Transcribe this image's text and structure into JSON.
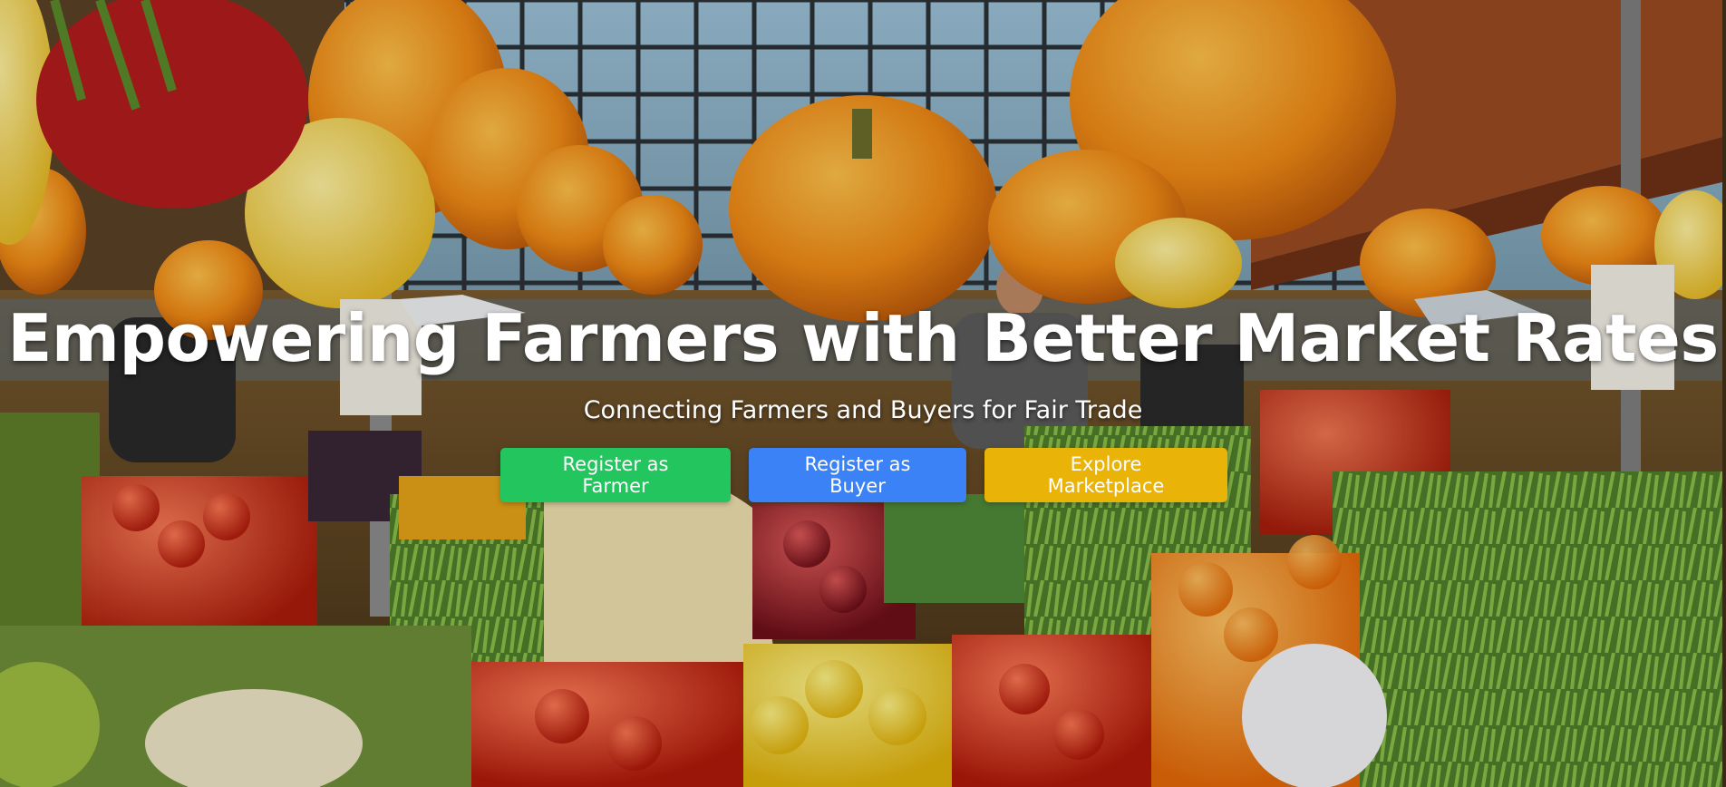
{
  "hero": {
    "title": "Empowering Farmers with Better Market Rates",
    "subtitle": "Connecting Farmers and Buyers for Fair Trade",
    "background": "farmers-market-photo"
  },
  "buttons": [
    {
      "label": "Register as Farmer",
      "color": "#22c55e"
    },
    {
      "label": "Register as Buyer",
      "color": "#3b82f6"
    },
    {
      "label": "Explore Marketplace",
      "color": "#eab308"
    }
  ]
}
